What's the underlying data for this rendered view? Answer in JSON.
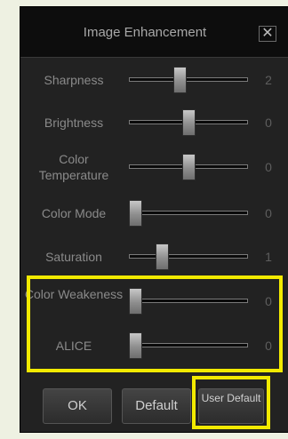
{
  "dialog": {
    "title": "Image Enhancement",
    "close_glyph": "✕"
  },
  "sliders": [
    {
      "label": "Sharpness",
      "value": "2",
      "position": 0.42
    },
    {
      "label": "Brightness",
      "value": "0",
      "position": 0.5
    },
    {
      "label": "Color Temperature",
      "value": "0",
      "position": 0.5
    },
    {
      "label": "Color Mode",
      "value": "0",
      "position": 0.0
    },
    {
      "label": "Saturation",
      "value": "1",
      "position": 0.25
    },
    {
      "label": "Color Weakeness",
      "value": "0",
      "position": 0.0
    },
    {
      "label": "ALICE",
      "value": "0",
      "position": 0.0
    }
  ],
  "buttons": {
    "ok": "OK",
    "default": "Default",
    "user_default": "User Default"
  },
  "colors": {
    "highlight": "#f2ea00",
    "panel": "#222222",
    "titlebar": "#0d0d0d"
  }
}
